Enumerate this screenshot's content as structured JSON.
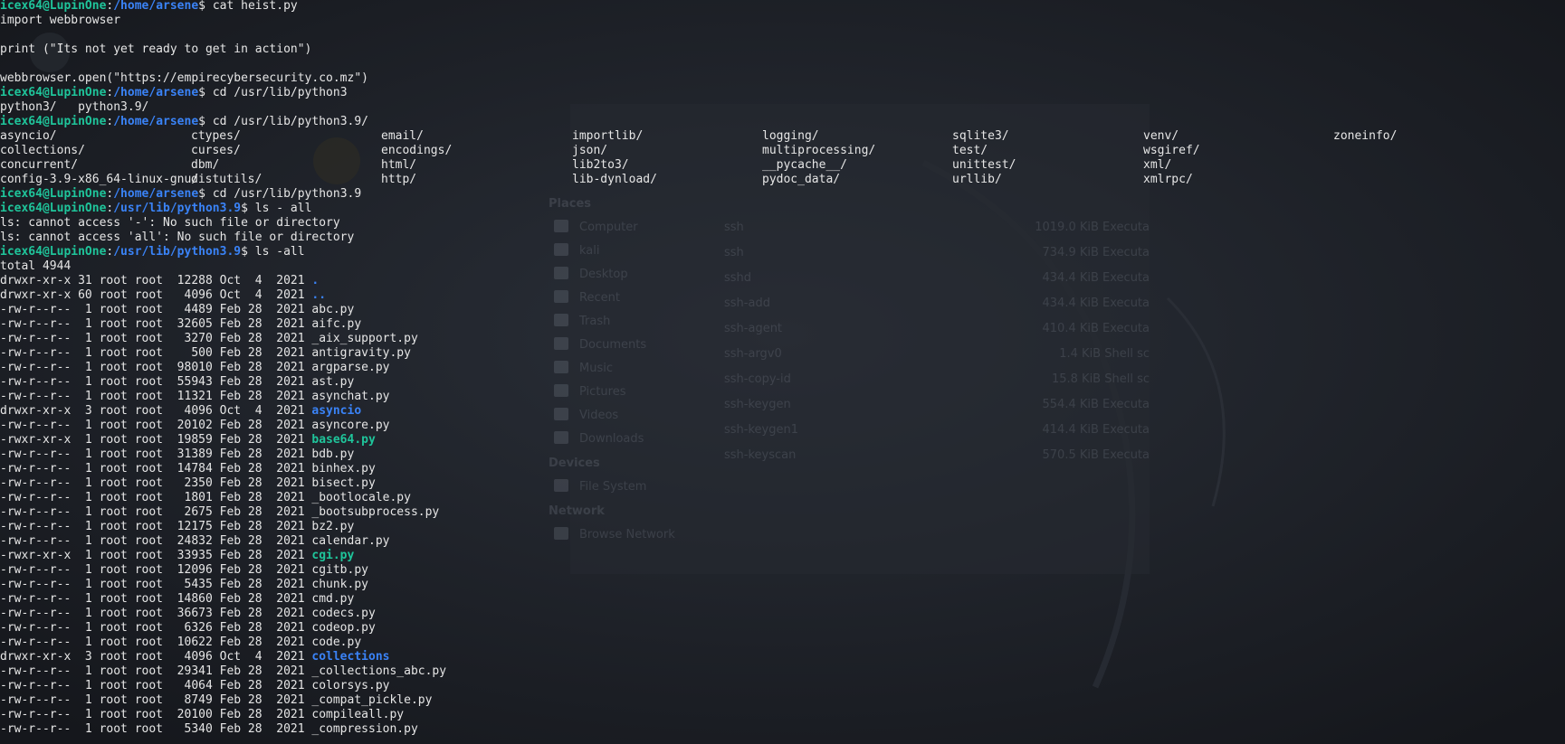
{
  "prompt": {
    "user_host": "icex64@LupinOne",
    "colon": ":",
    "dollar": "$ "
  },
  "session": [
    {
      "t": "cmd",
      "path": "/home/arsene",
      "cmd": "cat heist.py"
    },
    {
      "t": "out",
      "text": "import webbrowser"
    },
    {
      "t": "out",
      "text": ""
    },
    {
      "t": "out",
      "text": "print (\"Its not yet ready to get in action\")"
    },
    {
      "t": "out",
      "text": ""
    },
    {
      "t": "out",
      "text": "webbrowser.open(\"https://empirecybersecurity.co.mz\")"
    },
    {
      "t": "cmd",
      "path": "/home/arsene",
      "cmd": "cd /usr/lib/python3"
    },
    {
      "t": "out",
      "text": "python3/   python3.9/"
    },
    {
      "t": "cmd",
      "path": "/home/arsene",
      "cmd": "cd /usr/lib/python3.9/"
    },
    {
      "t": "cols",
      "cells": [
        "asyncio/",
        "ctypes/",
        "email/",
        "importlib/",
        "logging/",
        "sqlite3/",
        "venv/",
        "zoneinfo/"
      ]
    },
    {
      "t": "cols",
      "cells": [
        "collections/",
        "curses/",
        "encodings/",
        "json/",
        "multiprocessing/",
        "test/",
        "wsgiref/"
      ]
    },
    {
      "t": "cols",
      "cells": [
        "concurrent/",
        "dbm/",
        "html/",
        "lib2to3/",
        "__pycache__/",
        "unittest/",
        "xml/"
      ]
    },
    {
      "t": "cols",
      "cells": [
        "config-3.9-x86_64-linux-gnu/",
        "distutils/",
        "http/",
        "lib-dynload/",
        "pydoc_data/",
        "urllib/",
        "xmlrpc/"
      ]
    },
    {
      "t": "cmd",
      "path": "/home/arsene",
      "cmd": "cd /usr/lib/python3.9"
    },
    {
      "t": "cmd",
      "path": "/usr/lib/python3.9",
      "cmd": "ls - all"
    },
    {
      "t": "out",
      "text": "ls: cannot access '-': No such file or directory"
    },
    {
      "t": "out",
      "text": "ls: cannot access 'all': No such file or directory"
    },
    {
      "t": "cmd",
      "path": "/usr/lib/python3.9",
      "cmd": "ls -all"
    },
    {
      "t": "out",
      "text": "total 4944"
    },
    {
      "t": "ls",
      "meta": "drwxr-xr-x 31 root root  12288 Oct  4  2021 ",
      "name": ".",
      "k": "d"
    },
    {
      "t": "ls",
      "meta": "drwxr-xr-x 60 root root   4096 Oct  4  2021 ",
      "name": "..",
      "k": "d"
    },
    {
      "t": "ls",
      "meta": "-rw-r--r--  1 root root   4489 Feb 28  2021 ",
      "name": "abc.py",
      "k": "w"
    },
    {
      "t": "ls",
      "meta": "-rw-r--r--  1 root root  32605 Feb 28  2021 ",
      "name": "aifc.py",
      "k": "w"
    },
    {
      "t": "ls",
      "meta": "-rw-r--r--  1 root root   3270 Feb 28  2021 ",
      "name": "_aix_support.py",
      "k": "w"
    },
    {
      "t": "ls",
      "meta": "-rw-r--r--  1 root root    500 Feb 28  2021 ",
      "name": "antigravity.py",
      "k": "w"
    },
    {
      "t": "ls",
      "meta": "-rw-r--r--  1 root root  98010 Feb 28  2021 ",
      "name": "argparse.py",
      "k": "w"
    },
    {
      "t": "ls",
      "meta": "-rw-r--r--  1 root root  55943 Feb 28  2021 ",
      "name": "ast.py",
      "k": "w"
    },
    {
      "t": "ls",
      "meta": "-rw-r--r--  1 root root  11321 Feb 28  2021 ",
      "name": "asynchat.py",
      "k": "w"
    },
    {
      "t": "ls",
      "meta": "drwxr-xr-x  3 root root   4096 Oct  4  2021 ",
      "name": "asyncio",
      "k": "d"
    },
    {
      "t": "ls",
      "meta": "-rw-r--r--  1 root root  20102 Feb 28  2021 ",
      "name": "asyncore.py",
      "k": "w"
    },
    {
      "t": "ls",
      "meta": "-rwxr-xr-x  1 root root  19859 Feb 28  2021 ",
      "name": "base64.py",
      "k": "x"
    },
    {
      "t": "ls",
      "meta": "-rw-r--r--  1 root root  31389 Feb 28  2021 ",
      "name": "bdb.py",
      "k": "w"
    },
    {
      "t": "ls",
      "meta": "-rw-r--r--  1 root root  14784 Feb 28  2021 ",
      "name": "binhex.py",
      "k": "w"
    },
    {
      "t": "ls",
      "meta": "-rw-r--r--  1 root root   2350 Feb 28  2021 ",
      "name": "bisect.py",
      "k": "w"
    },
    {
      "t": "ls",
      "meta": "-rw-r--r--  1 root root   1801 Feb 28  2021 ",
      "name": "_bootlocale.py",
      "k": "w"
    },
    {
      "t": "ls",
      "meta": "-rw-r--r--  1 root root   2675 Feb 28  2021 ",
      "name": "_bootsubprocess.py",
      "k": "w"
    },
    {
      "t": "ls",
      "meta": "-rw-r--r--  1 root root  12175 Feb 28  2021 ",
      "name": "bz2.py",
      "k": "w"
    },
    {
      "t": "ls",
      "meta": "-rw-r--r--  1 root root  24832 Feb 28  2021 ",
      "name": "calendar.py",
      "k": "w"
    },
    {
      "t": "ls",
      "meta": "-rwxr-xr-x  1 root root  33935 Feb 28  2021 ",
      "name": "cgi.py",
      "k": "x"
    },
    {
      "t": "ls",
      "meta": "-rw-r--r--  1 root root  12096 Feb 28  2021 ",
      "name": "cgitb.py",
      "k": "w"
    },
    {
      "t": "ls",
      "meta": "-rw-r--r--  1 root root   5435 Feb 28  2021 ",
      "name": "chunk.py",
      "k": "w"
    },
    {
      "t": "ls",
      "meta": "-rw-r--r--  1 root root  14860 Feb 28  2021 ",
      "name": "cmd.py",
      "k": "w"
    },
    {
      "t": "ls",
      "meta": "-rw-r--r--  1 root root  36673 Feb 28  2021 ",
      "name": "codecs.py",
      "k": "w"
    },
    {
      "t": "ls",
      "meta": "-rw-r--r--  1 root root   6326 Feb 28  2021 ",
      "name": "codeop.py",
      "k": "w"
    },
    {
      "t": "ls",
      "meta": "-rw-r--r--  1 root root  10622 Feb 28  2021 ",
      "name": "code.py",
      "k": "w"
    },
    {
      "t": "ls",
      "meta": "drwxr-xr-x  3 root root   4096 Oct  4  2021 ",
      "name": "collections",
      "k": "d"
    },
    {
      "t": "ls",
      "meta": "-rw-r--r--  1 root root  29341 Feb 28  2021 ",
      "name": "_collections_abc.py",
      "k": "w"
    },
    {
      "t": "ls",
      "meta": "-rw-r--r--  1 root root   4064 Feb 28  2021 ",
      "name": "colorsys.py",
      "k": "w"
    },
    {
      "t": "ls",
      "meta": "-rw-r--r--  1 root root   8749 Feb 28  2021 ",
      "name": "_compat_pickle.py",
      "k": "w"
    },
    {
      "t": "ls",
      "meta": "-rw-r--r--  1 root root  20100 Feb 28  2021 ",
      "name": "compileall.py",
      "k": "w"
    },
    {
      "t": "ls",
      "meta": "-rw-r--r--  1 root root   5340 Feb 28  2021 ",
      "name": "_compression.py",
      "k": "w"
    }
  ],
  "background_file_manager": {
    "places_heading": "Places",
    "places": [
      "Computer",
      "kali",
      "Desktop",
      "Recent",
      "Trash",
      "Documents",
      "Music",
      "Pictures",
      "Videos",
      "Downloads"
    ],
    "devices_heading": "Devices",
    "devices": [
      "File System"
    ],
    "network_heading": "Network",
    "network": [
      "Browse Network"
    ],
    "files": [
      {
        "name": "ssh",
        "size": "1019.0 KiB",
        "kind": "Executa"
      },
      {
        "name": "ssh",
        "size": "734.9 KiB",
        "kind": "Executa"
      },
      {
        "name": "sshd",
        "size": "434.4 KiB",
        "kind": "Executa"
      },
      {
        "name": "ssh-add",
        "size": "434.4 KiB",
        "kind": "Executa"
      },
      {
        "name": "ssh-agent",
        "size": "410.4 KiB",
        "kind": "Executa"
      },
      {
        "name": "ssh-argv0",
        "size": "1.4 KiB",
        "kind": "Shell sc"
      },
      {
        "name": "ssh-copy-id",
        "size": "15.8 KiB",
        "kind": "Shell sc"
      },
      {
        "name": "ssh-keygen",
        "size": "554.4 KiB",
        "kind": "Executa"
      },
      {
        "name": "ssh-keygen1",
        "size": "414.4 KiB",
        "kind": "Executa"
      },
      {
        "name": "ssh-keyscan",
        "size": "570.5 KiB",
        "kind": "Executa"
      }
    ]
  },
  "colors": {
    "background": "#1b1e24",
    "user": "#1fc59b",
    "path": "#3a83f7",
    "text": "#e6e6e6",
    "dir": "#3a83f7",
    "exec": "#1fc59b"
  }
}
